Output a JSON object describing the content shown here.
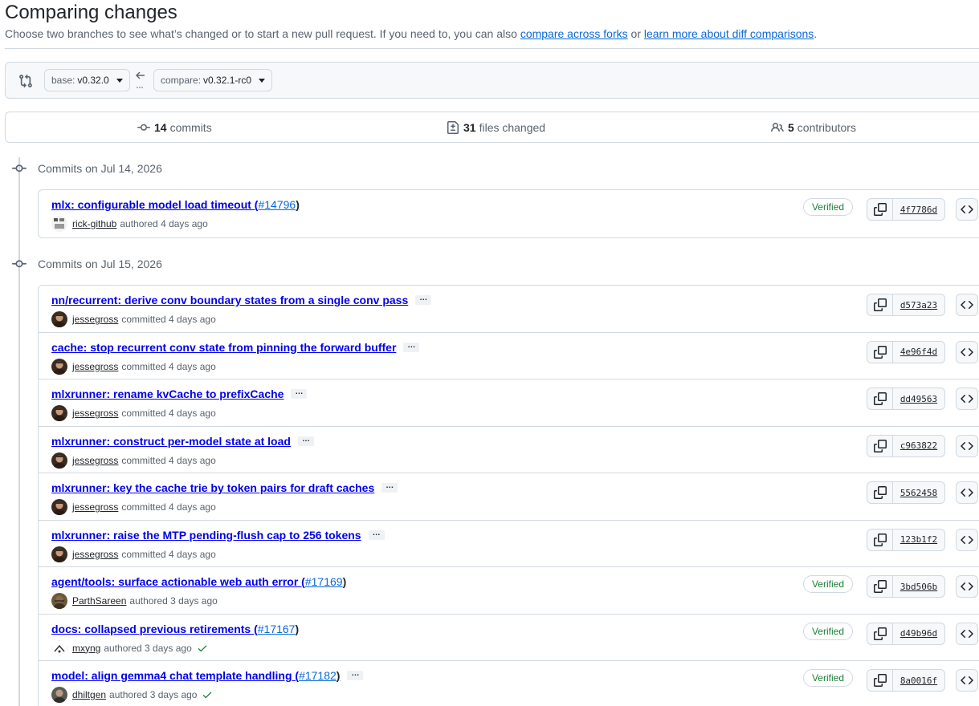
{
  "page": {
    "title": "Comparing changes",
    "subtitle_text": "Choose two branches to see what’s changed or to start a new pull request. If you need to, you can also ",
    "compare_forks_link": "compare across forks",
    "subtitle_or": " or ",
    "learn_more_link": "learn more about diff comparisons",
    "subtitle_end": "."
  },
  "range": {
    "base_label": "base:",
    "base_value": "v0.32.0",
    "compare_label": "compare:",
    "compare_value": "v0.32.1-rc0"
  },
  "summary": {
    "commits_count": "14",
    "commits_label": "commits",
    "files_count": "31",
    "files_label": "files changed",
    "contributors_count": "5",
    "contributors_label": "contributors"
  },
  "groups": [
    {
      "heading": "Commits on Jul 14, 2026",
      "commits": [
        {
          "title": "mlx: configurable model load timeout (",
          "pr": "#14796",
          "post": ")",
          "has_ellipsis": false,
          "author": "rick-github",
          "action": "authored 4 days ago",
          "verified": "Verified",
          "sha": "4f7786d",
          "check": false,
          "avatar": "rick"
        }
      ]
    },
    {
      "heading": "Commits on Jul 15, 2026",
      "commits": [
        {
          "title": "nn/recurrent: derive conv boundary states from a single conv pass",
          "pr": "",
          "post": "",
          "has_ellipsis": true,
          "author": "jessegross",
          "action": "committed 4 days ago",
          "verified": "",
          "sha": "d573a23",
          "check": false,
          "avatar": "jesse"
        },
        {
          "title": "cache: stop recurrent conv state from pinning the forward buffer",
          "pr": "",
          "post": "",
          "has_ellipsis": true,
          "author": "jessegross",
          "action": "committed 4 days ago",
          "verified": "",
          "sha": "4e96f4d",
          "check": false,
          "avatar": "jesse"
        },
        {
          "title": "mlxrunner: rename kvCache to prefixCache",
          "pr": "",
          "post": "",
          "has_ellipsis": true,
          "author": "jessegross",
          "action": "committed 4 days ago",
          "verified": "",
          "sha": "dd49563",
          "check": false,
          "avatar": "jesse"
        },
        {
          "title": "mlxrunner: construct per-model state at load",
          "pr": "",
          "post": "",
          "has_ellipsis": true,
          "author": "jessegross",
          "action": "committed 4 days ago",
          "verified": "",
          "sha": "c963822",
          "check": false,
          "avatar": "jesse"
        },
        {
          "title": "mlxrunner: key the cache trie by token pairs for draft caches",
          "pr": "",
          "post": "",
          "has_ellipsis": true,
          "author": "jessegross",
          "action": "committed 4 days ago",
          "verified": "",
          "sha": "5562458",
          "check": false,
          "avatar": "jesse"
        },
        {
          "title": "mlxrunner: raise the MTP pending-flush cap to 256 tokens",
          "pr": "",
          "post": "",
          "has_ellipsis": true,
          "author": "jessegross",
          "action": "committed 4 days ago",
          "verified": "",
          "sha": "123b1f2",
          "check": false,
          "avatar": "jesse"
        },
        {
          "title": "agent/tools: surface actionable web auth error (",
          "pr": "#17169",
          "post": ")",
          "has_ellipsis": false,
          "author": "ParthSareen",
          "action": "authored 3 days ago",
          "verified": "Verified",
          "sha": "3bd506b",
          "check": false,
          "avatar": "parth"
        },
        {
          "title": "docs: collapsed previous retirements (",
          "pr": "#17167",
          "post": ")",
          "has_ellipsis": false,
          "author": "mxyng",
          "action": "authored 3 days ago",
          "verified": "Verified",
          "sha": "d49b96d",
          "check": true,
          "avatar": "mxyng"
        },
        {
          "title": "model: align gemma4 chat template handling (",
          "pr": "#17182",
          "post": ")",
          "has_ellipsis": true,
          "author": "dhiltgen",
          "action": "authored 3 days ago",
          "verified": "Verified",
          "sha": "8a0016f",
          "check": true,
          "avatar": "dhilt"
        }
      ]
    }
  ],
  "colors": {
    "link": "#0969da",
    "verified": "#1a7f37",
    "muted": "#59636e",
    "border": "#d1d9e0"
  },
  "icons": [
    "git-compare-icon",
    "arrow-left-icon",
    "git-commit-icon",
    "file-diff-icon",
    "people-icon",
    "copy-icon",
    "code-icon",
    "check-icon"
  ]
}
